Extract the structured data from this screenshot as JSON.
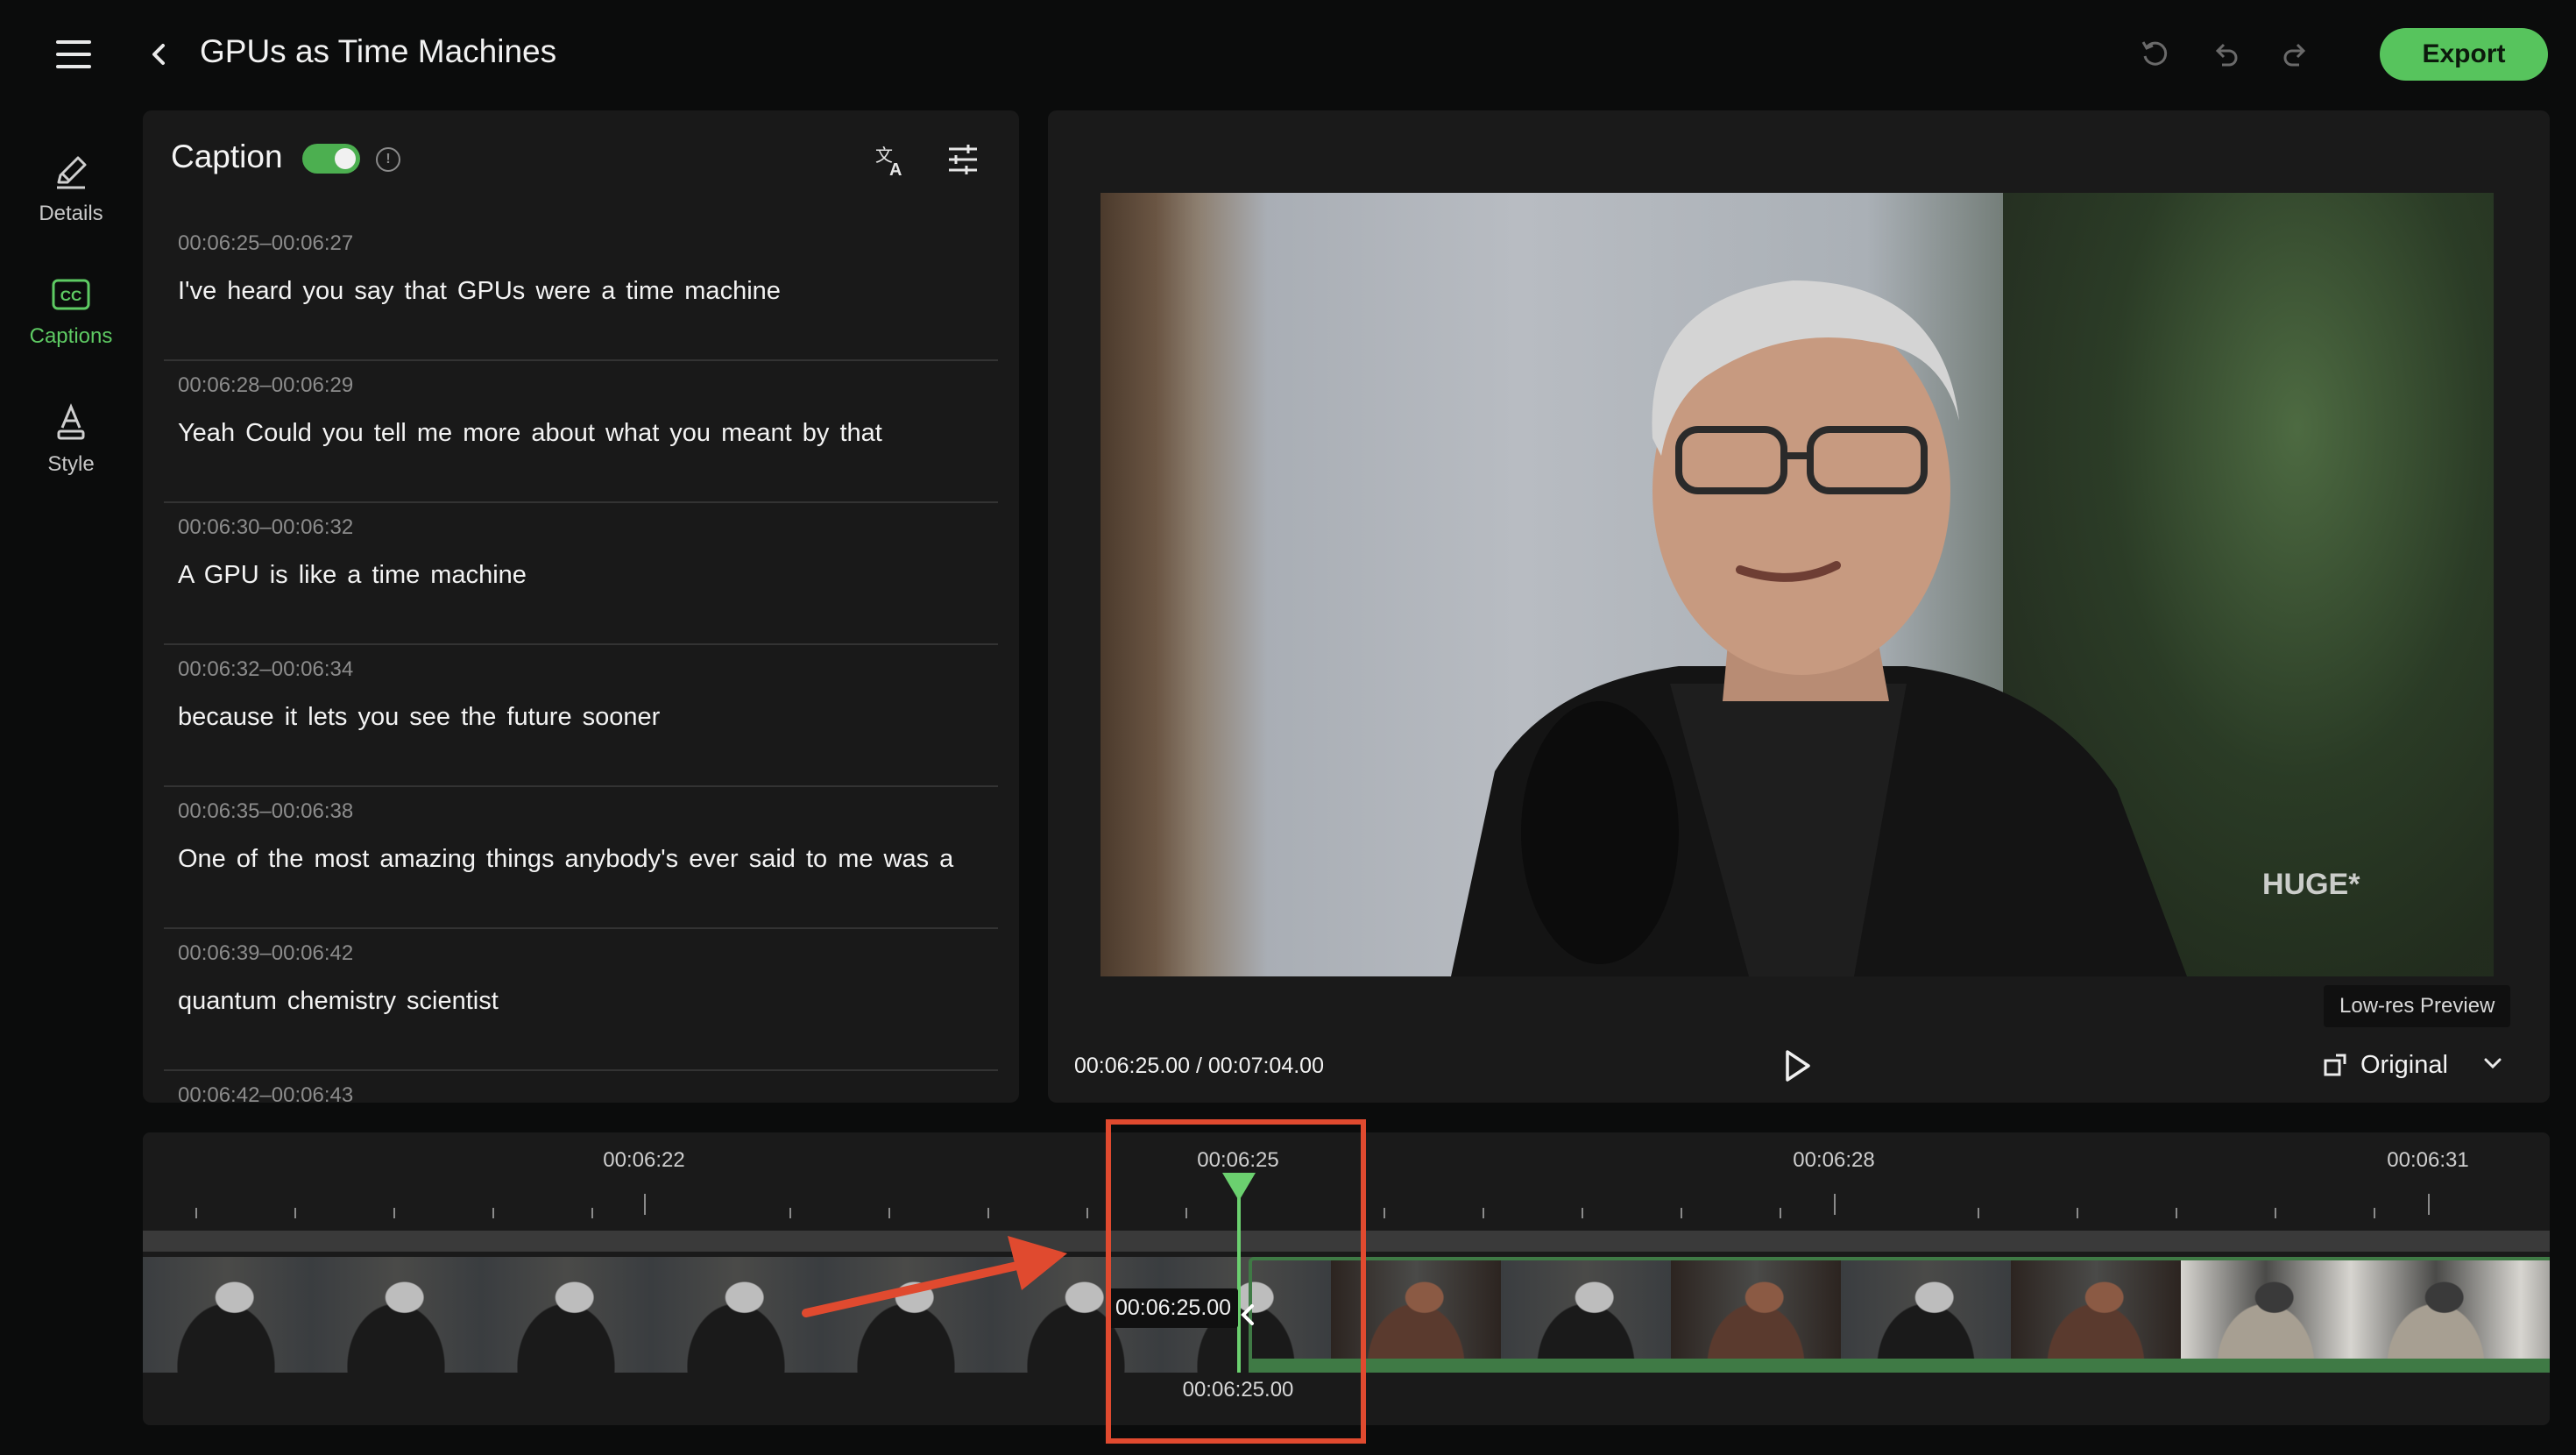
{
  "header": {
    "title": "GPUs as Time Machines",
    "export_label": "Export"
  },
  "rail": {
    "items": [
      {
        "label": "Details",
        "icon": "pencil-icon"
      },
      {
        "label": "Captions",
        "icon": "cc-icon",
        "active": true
      },
      {
        "label": "Style",
        "icon": "text-style-icon"
      }
    ]
  },
  "caption_panel": {
    "title": "Caption",
    "toggle_on": true,
    "items": [
      {
        "time": "00:06:25–00:06:27",
        "text": "I've heard you say that GPUs were a time machine"
      },
      {
        "time": "00:06:28–00:06:29",
        "text": "Yeah Could you tell me more about what you meant by that"
      },
      {
        "time": "00:06:30–00:06:32",
        "text": "A GPU is like a time machine"
      },
      {
        "time": "00:06:32–00:06:34",
        "text": "because it lets you see the future sooner"
      },
      {
        "time": "00:06:35–00:06:38",
        "text": "One of the most amazing things anybody's ever said to me was a"
      },
      {
        "time": "00:06:39–00:06:42",
        "text": "quantum chemistry scientist"
      },
      {
        "time": "00:06:42–00:06:43",
        "text": ""
      }
    ]
  },
  "preview": {
    "watermark": "HUGE*",
    "lowres_label": "Low-res Preview",
    "timecode": "00:06:25.00 / 00:07:04.00",
    "aspect_label": "Original"
  },
  "timeline": {
    "labels": [
      "00:06:22",
      "00:06:25",
      "00:06:28",
      "00:06:31"
    ],
    "playhead_tag": "00:06:25.00",
    "playhead_below": "00:06:25.00"
  },
  "colors": {
    "accent": "#57c45d",
    "annotation": "#e04a2f",
    "panel": "#1a1a1a",
    "background": "#0b0c0c"
  }
}
